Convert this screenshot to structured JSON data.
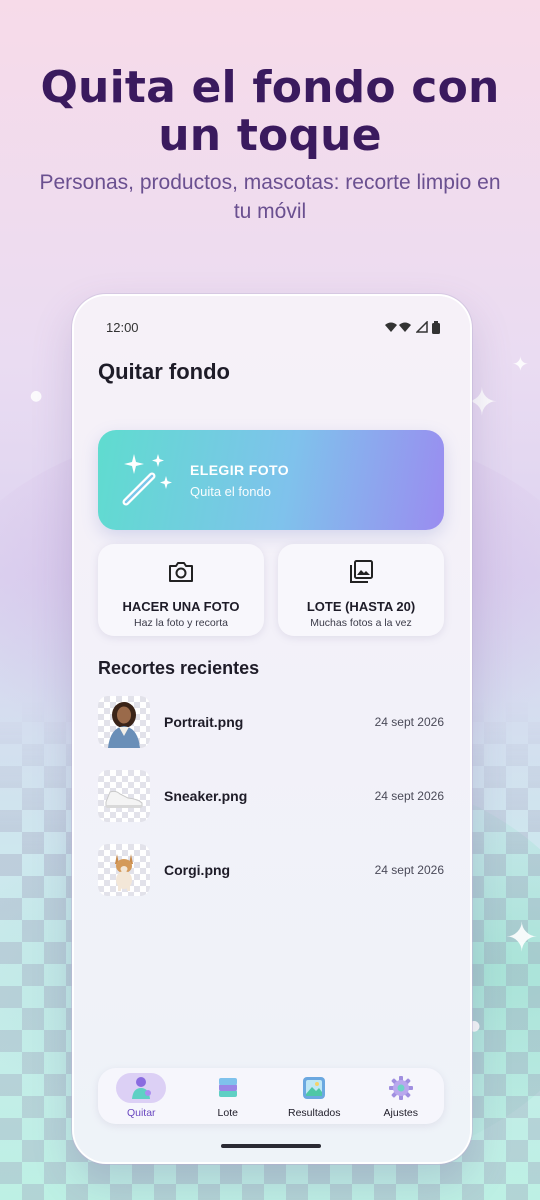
{
  "hero": {
    "title": "Quita el fondo con un toque",
    "subtitle": "Personas, productos, mascotas: recorte limpio en tu móvil"
  },
  "status_bar": {
    "time": "12:00",
    "icons": [
      "wifi-icon",
      "signal-icon",
      "battery-icon"
    ]
  },
  "app": {
    "title": "Quitar fondo"
  },
  "main_action": {
    "label": "ELEGIR FOTO",
    "sublabel": "Quita el fondo",
    "icon": "magic-wand-icon"
  },
  "actions": [
    {
      "label": "HACER UNA FOTO",
      "sublabel": "Haz la foto y recorta",
      "icon": "camera-icon"
    },
    {
      "label": "LOTE (HASTA 20)",
      "sublabel": "Muchas fotos a la vez",
      "icon": "photo-stack-icon"
    }
  ],
  "recent": {
    "title": "Recortes recientes",
    "items": [
      {
        "name": "Portrait.png",
        "date": "24 sept 2026",
        "icon": "person-thumbnail"
      },
      {
        "name": "Sneaker.png",
        "date": "24 sept 2026",
        "icon": "sneaker-thumbnail"
      },
      {
        "name": "Corgi.png",
        "date": "24 sept 2026",
        "icon": "corgi-thumbnail"
      }
    ]
  },
  "nav": {
    "items": [
      {
        "label": "Quitar",
        "active": true,
        "icon": "person-icon"
      },
      {
        "label": "Lote",
        "active": false,
        "icon": "layers-icon"
      },
      {
        "label": "Resultados",
        "active": false,
        "icon": "gallery-icon"
      },
      {
        "label": "Ajustes",
        "active": false,
        "icon": "gear-icon"
      }
    ]
  },
  "colors": {
    "title": "#3a1a5e",
    "accent": "#6a48c0",
    "gradient_start": "#5fdccf",
    "gradient_end": "#9a8cf0"
  }
}
